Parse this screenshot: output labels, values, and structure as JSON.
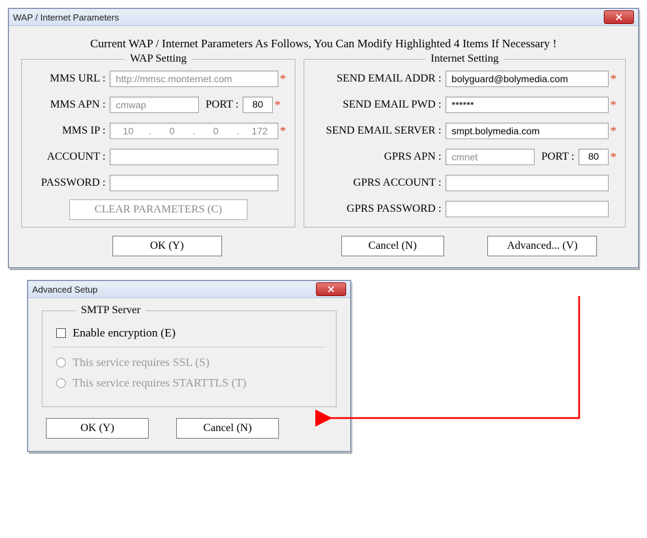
{
  "win1": {
    "title": "WAP / Internet Parameters",
    "headline": "Current WAP / Internet Parameters As Follows, You Can Modify Highlighted 4 Items If Necessary !",
    "wap": {
      "legend": "WAP Setting",
      "mms_url_label": "MMS URL :",
      "mms_url": "http://mmsc.monternet.com",
      "mms_apn_label": "MMS APN :",
      "mms_apn": "cmwap",
      "port_label": "PORT :",
      "mms_port": "80",
      "mms_ip_label": "MMS IP :",
      "ip": [
        "10",
        "0",
        "0",
        "172"
      ],
      "account_label": "ACCOUNT :",
      "account": "",
      "password_label": "PASSWORD :",
      "password": "",
      "clear_btn": "CLEAR PARAMETERS (C)"
    },
    "internet": {
      "legend": "Internet Setting",
      "send_addr_label": "SEND EMAIL ADDR :",
      "send_addr": "bolyguard@bolymedia.com",
      "send_pwd_label": "SEND EMAIL PWD :",
      "send_pwd": "******",
      "send_server_label": "SEND EMAIL SERVER :",
      "send_server": "smpt.bolymedia.com",
      "gprs_apn_label": "GPRS APN :",
      "gprs_apn": "cmnet",
      "gprs_port_label": "PORT :",
      "gprs_port": "80",
      "gprs_account_label": "GPRS ACCOUNT :",
      "gprs_account": "",
      "gprs_password_label": "GPRS PASSWORD :",
      "gprs_password": ""
    },
    "footer": {
      "ok": "OK (Y)",
      "cancel": "Cancel (N)",
      "advanced": "Advanced... (V)"
    }
  },
  "win2": {
    "title": "Advanced Setup",
    "group_legend": "SMTP Server",
    "enable_encryption": "Enable encryption (E)",
    "ssl": "This service requires SSL (S)",
    "starttls": "This service requires  STARTTLS (T)",
    "ok": "OK (Y)",
    "cancel": "Cancel (N)"
  },
  "stars": "*"
}
